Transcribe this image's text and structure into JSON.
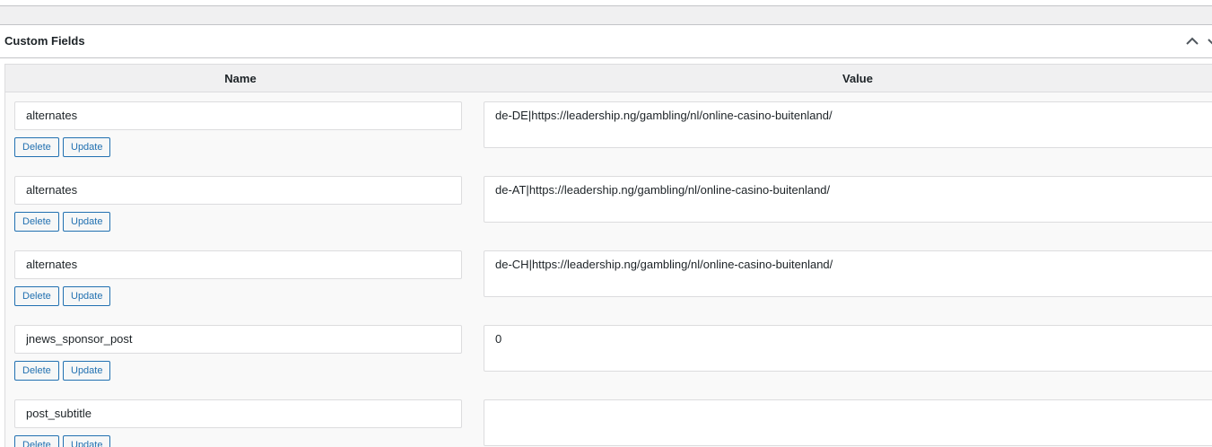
{
  "metabox": {
    "title": "Custom Fields"
  },
  "table": {
    "headers": {
      "name": "Name",
      "value": "Value"
    },
    "rows": [
      {
        "name": "alternates",
        "value": "de-DE|https://leadership.ng/gambling/nl/online-casino-buitenland/"
      },
      {
        "name": "alternates",
        "value": "de-AT|https://leadership.ng/gambling/nl/online-casino-buitenland/"
      },
      {
        "name": "alternates",
        "value": "de-CH|https://leadership.ng/gambling/nl/online-casino-buitenland/"
      },
      {
        "name": "jnews_sponsor_post",
        "value": "0"
      },
      {
        "name": "post_subtitle",
        "value": ""
      }
    ]
  },
  "buttons": {
    "delete_label": "Delete",
    "update_label": "Update"
  },
  "icons": {
    "collapse": "chevron-up-icon",
    "expand": "chevron-down-icon"
  },
  "colors": {
    "accent": "#2271b1",
    "border": "#c3c4c7"
  }
}
